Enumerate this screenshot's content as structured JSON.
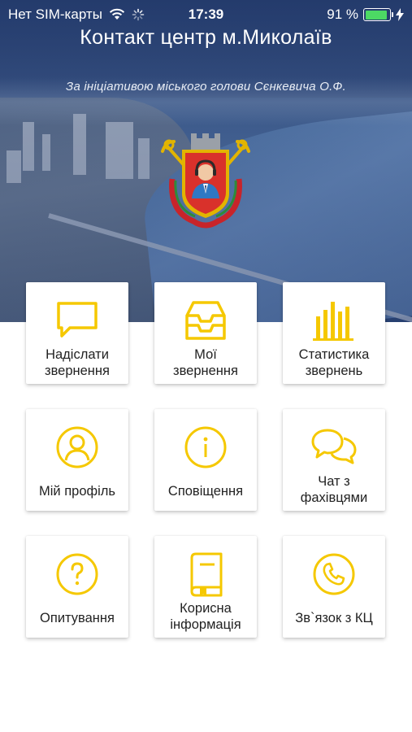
{
  "status_bar": {
    "carrier": "Нет SIM-карты",
    "time": "17:39",
    "battery_percent": "91 %",
    "battery_level": 0.91
  },
  "header": {
    "title": "Контакт центр м.Миколаїв",
    "subtitle": "За ініціативою міського голови Сєнкевича О.Ф."
  },
  "colors": {
    "accent": "#f5c800",
    "battery": "#4cd964",
    "emblem_red": "#d9312b",
    "emblem_gold": "#e2b400"
  },
  "menu": [
    {
      "label": "Надіслати\nзвернення",
      "icon": "message-icon"
    },
    {
      "label": "Мої\nзвернення",
      "icon": "inbox-icon"
    },
    {
      "label": "Статистика\nзвернень",
      "icon": "bar-chart-icon"
    },
    {
      "label": "Мій профіль",
      "icon": "user-icon"
    },
    {
      "label": "Сповіщення",
      "icon": "info-icon"
    },
    {
      "label": "Чат з\nфахівцями",
      "icon": "chat-icon"
    },
    {
      "label": "Опитування",
      "icon": "question-icon"
    },
    {
      "label": "Корисна\nінформація",
      "icon": "book-icon"
    },
    {
      "label": "Зв`язок з КЦ",
      "icon": "phone-icon"
    }
  ]
}
